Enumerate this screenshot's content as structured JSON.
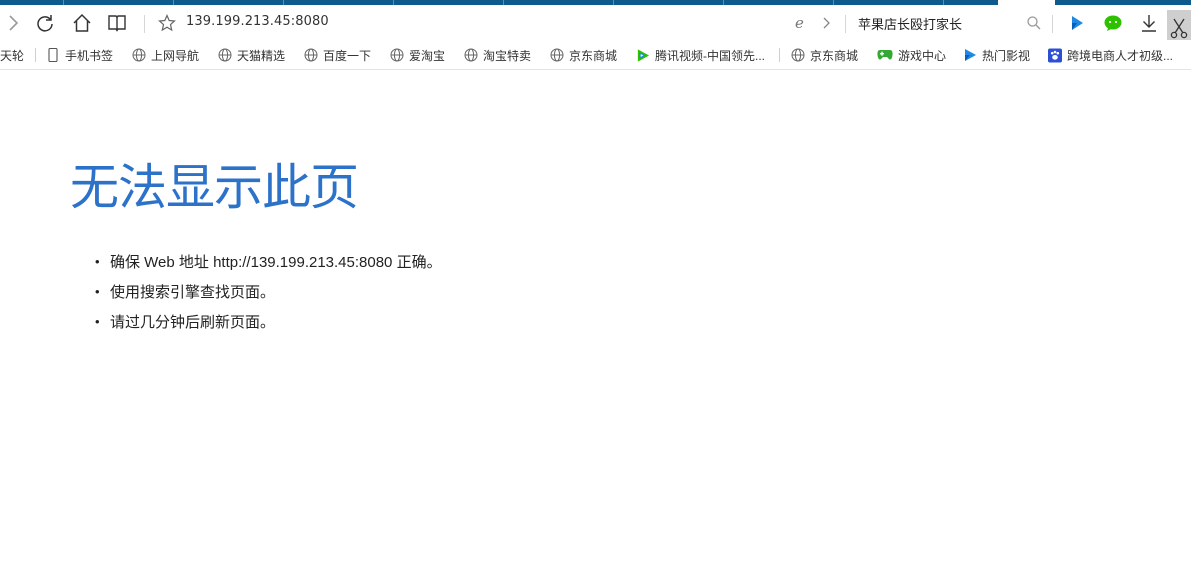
{
  "toolbar": {
    "address": "139.199.213.45:8080",
    "search_text": "苹果店长殴打家长"
  },
  "favorites": [
    {
      "label": "天轮",
      "icon": "none"
    },
    {
      "label": "手机书签",
      "icon": "phone-icon"
    },
    {
      "label": "上网导航",
      "icon": "globe-icon"
    },
    {
      "label": "天猫精选",
      "icon": "globe-icon"
    },
    {
      "label": "百度一下",
      "icon": "globe-icon"
    },
    {
      "label": "爱淘宝",
      "icon": "globe-icon"
    },
    {
      "label": "淘宝特卖",
      "icon": "globe-icon"
    },
    {
      "label": "京东商城",
      "icon": "globe-icon"
    },
    {
      "label": "腾讯视频-中国领先...",
      "icon": "tencent-video-icon"
    },
    {
      "label": "京东商城",
      "icon": "globe-icon"
    },
    {
      "label": "游戏中心",
      "icon": "gamepad-icon"
    },
    {
      "label": "热门影视",
      "icon": "play-icon"
    },
    {
      "label": "跨境电商人才初级...",
      "icon": "paw-icon"
    }
  ],
  "error": {
    "title": "无法显示此页",
    "items": [
      "确保 Web 地址 http://139.199.213.45:8080 正确。",
      "使用搜索引擎查找页面。",
      "请过几分钟后刷新页面。"
    ]
  },
  "colors": {
    "tab_strip": "#0f5a8c",
    "title": "#2c72c9",
    "wechat_green": "#2dc100",
    "video_blue": "#1e88e5"
  }
}
